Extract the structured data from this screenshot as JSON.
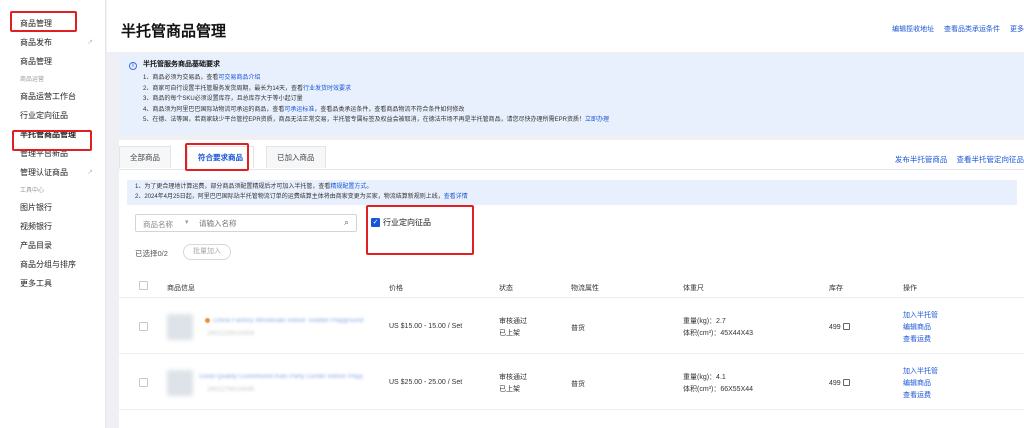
{
  "sidebar": {
    "items": [
      {
        "label": "商品管理",
        "type": "item"
      },
      {
        "label": "商品发布",
        "type": "item",
        "arrow": "↗"
      },
      {
        "label": "商品管理",
        "type": "item"
      },
      {
        "label": "商品运营",
        "type": "group"
      },
      {
        "label": "商品运营工作台",
        "type": "item"
      },
      {
        "label": "行业定向征品",
        "type": "item"
      },
      {
        "label": "半托管商品管理",
        "type": "item",
        "active": true
      },
      {
        "label": "管理平台新品",
        "type": "item"
      },
      {
        "label": "管理认证商品",
        "type": "item",
        "arrow": "↗"
      },
      {
        "label": "工具中心",
        "type": "group"
      },
      {
        "label": "图片银行",
        "type": "item"
      },
      {
        "label": "视频银行",
        "type": "item"
      },
      {
        "label": "产品目录",
        "type": "item"
      },
      {
        "label": "商品分组与排序",
        "type": "item"
      },
      {
        "label": "更多工具",
        "type": "item"
      }
    ]
  },
  "header": {
    "title": "半托管商品管理",
    "links": [
      "编辑揽收地址",
      "查看品类承运条件",
      "更多"
    ]
  },
  "notice": {
    "title": "半托管服务商品基础要求",
    "lines": [
      {
        "pre": "1、商品必须为交易品，查看",
        "link": "可交易商品介绍",
        "post": ""
      },
      {
        "pre": "2、商家可自行设置半托管服务发货周期，最长为14天，查看",
        "link": "行业发货时效要求",
        "post": ""
      },
      {
        "pre": "3、商品的每个SKU必须设置库存，且总库存大于等小起订量",
        "link": "",
        "post": ""
      },
      {
        "pre": "4、商品须为阿里巴巴国际站物流可承运的商品，查看",
        "link": "可承运标准",
        "post": "，查看品类承运条件，查看商品物流不符合条件如何修改"
      },
      {
        "pre": "5、在德、法等国，若商家缺少平台管控EPR资质，商品无法正常交易，半托管专属标签及权益会被取消，在德法市场不再是半托管商品，请您尽快办理所需EPR资质！",
        "link": "立即办理",
        "post": ""
      }
    ]
  },
  "tabs": [
    {
      "label": "全部商品",
      "active": false
    },
    {
      "label": "符合要求商品",
      "active": true
    },
    {
      "label": "已加入商品",
      "active": false
    }
  ],
  "tab_actions": [
    "发布半托管商品",
    "查看半托管定向征品"
  ],
  "notice2": {
    "lines": [
      {
        "pre": "1、为了更合理地计算运费，部分商品须配置精规后才可加入半托管，查看",
        "link": "精规配置方式",
        "post": "。"
      },
      {
        "pre": "2、2024年4月25日起，阿里巴巴国际站半托管物流订单的运费结算主体将由商家变更为买家，物流结算新规则上线，",
        "link": "查看详情",
        "post": ""
      }
    ]
  },
  "search": {
    "select_label": "商品名称",
    "placeholder": "请输入名称"
  },
  "filter": {
    "industry_label": "行业定向征品",
    "checked": true
  },
  "selection": {
    "count_label": "已选择0/2",
    "batch_label": "批量加入"
  },
  "table": {
    "headers": [
      "商品信息",
      "价格",
      "状态",
      "物流属性",
      "体重尺",
      "库存",
      "操作"
    ],
    "rows": [
      {
        "title": "China Factory Wholesale Indoor Toddler Playground",
        "id": "1601215010403",
        "price": "US $15.00 - 15.00 / Set",
        "status": [
          "审核通过",
          "已上架"
        ],
        "logistics": "普货",
        "weight": "重量(kg)：2.7",
        "volume": "体积(cm³)：45X44X43",
        "stock": "499",
        "ops": [
          "加入半托管",
          "编辑商品",
          "查看运费"
        ]
      },
      {
        "title": "Good Quality Customized Kids Party Center Indoor Playground",
        "id": "1601276010446",
        "price": "US $25.00 - 25.00 / Set",
        "status": [
          "审核通过",
          "已上架"
        ],
        "logistics": "普货",
        "weight": "重量(kg)：4.1",
        "volume": "体积(cm³)：66X55X44",
        "stock": "499",
        "ops": [
          "加入半托管",
          "编辑商品",
          "查看运费"
        ]
      }
    ]
  }
}
